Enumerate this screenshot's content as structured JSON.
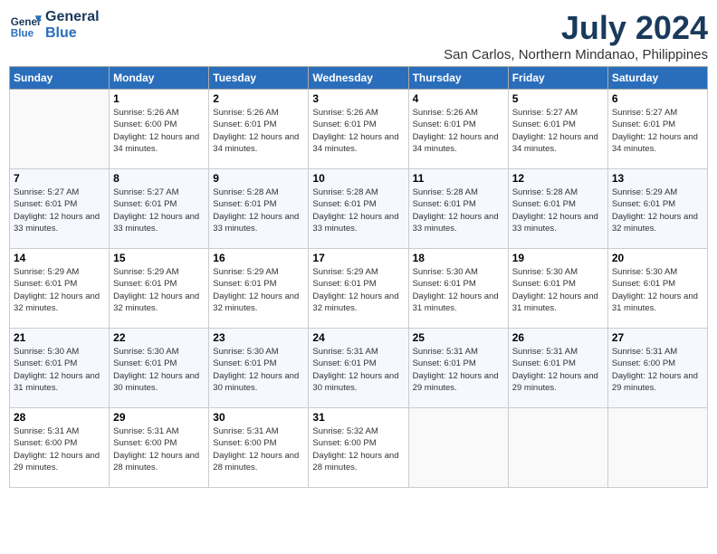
{
  "logo": {
    "line1": "General",
    "line2": "Blue"
  },
  "title": "July 2024",
  "location": "San Carlos, Northern Mindanao, Philippines",
  "days_of_week": [
    "Sunday",
    "Monday",
    "Tuesday",
    "Wednesday",
    "Thursday",
    "Friday",
    "Saturday"
  ],
  "weeks": [
    [
      {
        "num": "",
        "empty": true
      },
      {
        "num": "1",
        "sunrise": "5:26 AM",
        "sunset": "6:00 PM",
        "daylight": "12 hours and 34 minutes."
      },
      {
        "num": "2",
        "sunrise": "5:26 AM",
        "sunset": "6:01 PM",
        "daylight": "12 hours and 34 minutes."
      },
      {
        "num": "3",
        "sunrise": "5:26 AM",
        "sunset": "6:01 PM",
        "daylight": "12 hours and 34 minutes."
      },
      {
        "num": "4",
        "sunrise": "5:26 AM",
        "sunset": "6:01 PM",
        "daylight": "12 hours and 34 minutes."
      },
      {
        "num": "5",
        "sunrise": "5:27 AM",
        "sunset": "6:01 PM",
        "daylight": "12 hours and 34 minutes."
      },
      {
        "num": "6",
        "sunrise": "5:27 AM",
        "sunset": "6:01 PM",
        "daylight": "12 hours and 34 minutes."
      }
    ],
    [
      {
        "num": "7",
        "sunrise": "5:27 AM",
        "sunset": "6:01 PM",
        "daylight": "12 hours and 33 minutes."
      },
      {
        "num": "8",
        "sunrise": "5:27 AM",
        "sunset": "6:01 PM",
        "daylight": "12 hours and 33 minutes."
      },
      {
        "num": "9",
        "sunrise": "5:28 AM",
        "sunset": "6:01 PM",
        "daylight": "12 hours and 33 minutes."
      },
      {
        "num": "10",
        "sunrise": "5:28 AM",
        "sunset": "6:01 PM",
        "daylight": "12 hours and 33 minutes."
      },
      {
        "num": "11",
        "sunrise": "5:28 AM",
        "sunset": "6:01 PM",
        "daylight": "12 hours and 33 minutes."
      },
      {
        "num": "12",
        "sunrise": "5:28 AM",
        "sunset": "6:01 PM",
        "daylight": "12 hours and 33 minutes."
      },
      {
        "num": "13",
        "sunrise": "5:29 AM",
        "sunset": "6:01 PM",
        "daylight": "12 hours and 32 minutes."
      }
    ],
    [
      {
        "num": "14",
        "sunrise": "5:29 AM",
        "sunset": "6:01 PM",
        "daylight": "12 hours and 32 minutes."
      },
      {
        "num": "15",
        "sunrise": "5:29 AM",
        "sunset": "6:01 PM",
        "daylight": "12 hours and 32 minutes."
      },
      {
        "num": "16",
        "sunrise": "5:29 AM",
        "sunset": "6:01 PM",
        "daylight": "12 hours and 32 minutes."
      },
      {
        "num": "17",
        "sunrise": "5:29 AM",
        "sunset": "6:01 PM",
        "daylight": "12 hours and 32 minutes."
      },
      {
        "num": "18",
        "sunrise": "5:30 AM",
        "sunset": "6:01 PM",
        "daylight": "12 hours and 31 minutes."
      },
      {
        "num": "19",
        "sunrise": "5:30 AM",
        "sunset": "6:01 PM",
        "daylight": "12 hours and 31 minutes."
      },
      {
        "num": "20",
        "sunrise": "5:30 AM",
        "sunset": "6:01 PM",
        "daylight": "12 hours and 31 minutes."
      }
    ],
    [
      {
        "num": "21",
        "sunrise": "5:30 AM",
        "sunset": "6:01 PM",
        "daylight": "12 hours and 31 minutes."
      },
      {
        "num": "22",
        "sunrise": "5:30 AM",
        "sunset": "6:01 PM",
        "daylight": "12 hours and 30 minutes."
      },
      {
        "num": "23",
        "sunrise": "5:30 AM",
        "sunset": "6:01 PM",
        "daylight": "12 hours and 30 minutes."
      },
      {
        "num": "24",
        "sunrise": "5:31 AM",
        "sunset": "6:01 PM",
        "daylight": "12 hours and 30 minutes."
      },
      {
        "num": "25",
        "sunrise": "5:31 AM",
        "sunset": "6:01 PM",
        "daylight": "12 hours and 29 minutes."
      },
      {
        "num": "26",
        "sunrise": "5:31 AM",
        "sunset": "6:01 PM",
        "daylight": "12 hours and 29 minutes."
      },
      {
        "num": "27",
        "sunrise": "5:31 AM",
        "sunset": "6:00 PM",
        "daylight": "12 hours and 29 minutes."
      }
    ],
    [
      {
        "num": "28",
        "sunrise": "5:31 AM",
        "sunset": "6:00 PM",
        "daylight": "12 hours and 29 minutes."
      },
      {
        "num": "29",
        "sunrise": "5:31 AM",
        "sunset": "6:00 PM",
        "daylight": "12 hours and 28 minutes."
      },
      {
        "num": "30",
        "sunrise": "5:31 AM",
        "sunset": "6:00 PM",
        "daylight": "12 hours and 28 minutes."
      },
      {
        "num": "31",
        "sunrise": "5:32 AM",
        "sunset": "6:00 PM",
        "daylight": "12 hours and 28 minutes."
      },
      {
        "num": "",
        "empty": true
      },
      {
        "num": "",
        "empty": true
      },
      {
        "num": "",
        "empty": true
      }
    ]
  ],
  "labels": {
    "sunrise_prefix": "Sunrise: ",
    "sunset_prefix": "Sunset: ",
    "daylight_prefix": "Daylight: "
  }
}
